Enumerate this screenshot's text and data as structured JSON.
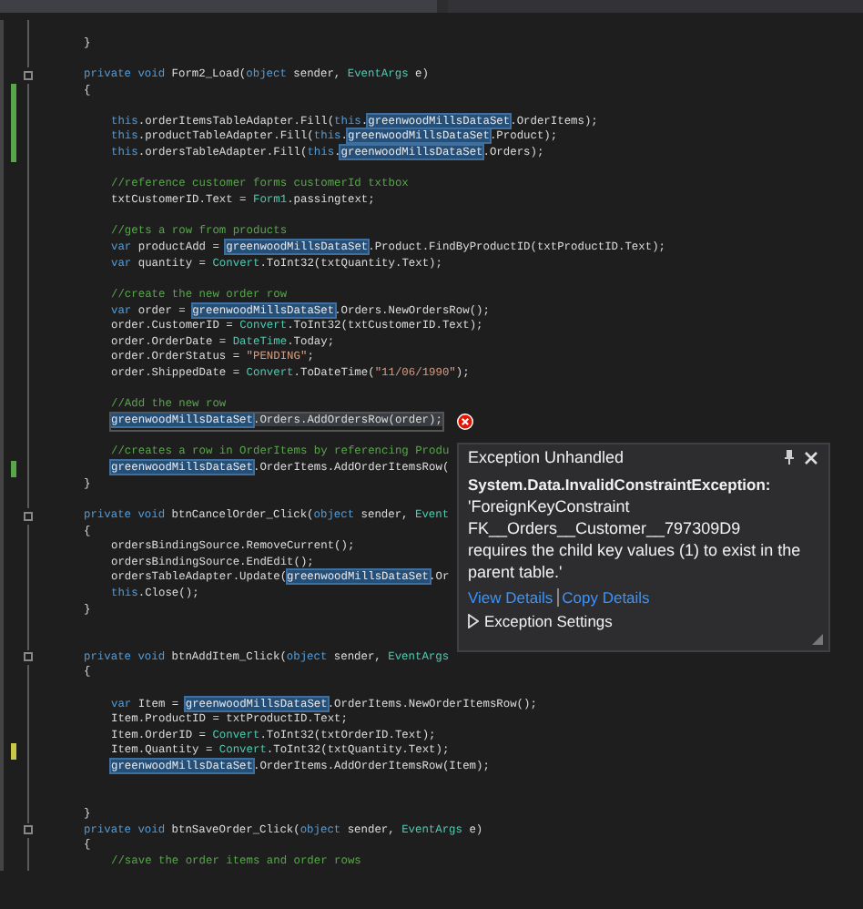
{
  "editor": {
    "lines": [
      {
        "kind": "blank"
      },
      {
        "kind": "member",
        "tokens": [
          {
            "kind": "plain",
            "s": "}"
          }
        ]
      },
      {
        "kind": "blank"
      },
      {
        "kind": "member",
        "fold": true,
        "tokens": [
          {
            "kind": "kw",
            "s": "private void "
          },
          {
            "kind": "plain",
            "s": "Form2_Load("
          },
          {
            "kind": "kw",
            "s": "object "
          },
          {
            "kind": "plain",
            "s": "sender, "
          },
          {
            "kind": "type",
            "s": "EventArgs "
          },
          {
            "kind": "plain",
            "s": "e)"
          }
        ]
      },
      {
        "kind": "member",
        "changed": true,
        "saved": true,
        "tokens": [
          {
            "kind": "plain",
            "s": "{"
          }
        ]
      },
      {
        "kind": "blank",
        "changed": true,
        "saved": true
      },
      {
        "kind": "body",
        "changed": true,
        "saved": true,
        "tokens": [
          {
            "kind": "kw",
            "s": "this"
          },
          {
            "kind": "plain",
            "s": ".orderItemsTableAdapter.Fill("
          },
          {
            "kind": "kw",
            "s": "this"
          },
          {
            "kind": "plain",
            "s": "."
          },
          {
            "kind": "hl",
            "s": "greenwoodMillsDataSet"
          },
          {
            "kind": "plain",
            "s": ".OrderItems);"
          }
        ]
      },
      {
        "kind": "body",
        "changed": true,
        "saved": true,
        "tokens": [
          {
            "kind": "kw",
            "s": "this"
          },
          {
            "kind": "plain",
            "s": ".productTableAdapter.Fill("
          },
          {
            "kind": "kw",
            "s": "this"
          },
          {
            "kind": "plain",
            "s": "."
          },
          {
            "kind": "hl",
            "s": "greenwoodMillsDataSet"
          },
          {
            "kind": "plain",
            "s": ".Product);"
          }
        ]
      },
      {
        "kind": "body",
        "changed": true,
        "saved": true,
        "tokens": [
          {
            "kind": "kw",
            "s": "this"
          },
          {
            "kind": "plain",
            "s": ".ordersTableAdapter.Fill("
          },
          {
            "kind": "kw",
            "s": "this"
          },
          {
            "kind": "plain",
            "s": "."
          },
          {
            "kind": "hl",
            "s": "greenwoodMillsDataSet"
          },
          {
            "kind": "plain",
            "s": ".Orders);"
          }
        ]
      },
      {
        "kind": "blank"
      },
      {
        "kind": "body",
        "tokens": [
          {
            "kind": "cmt",
            "s": "//reference customer forms customerId txtbox"
          }
        ]
      },
      {
        "kind": "body",
        "tokens": [
          {
            "kind": "plain",
            "s": "txtCustomerID.Text = "
          },
          {
            "kind": "type",
            "s": "Form1"
          },
          {
            "kind": "plain",
            "s": ".passingtext;"
          }
        ]
      },
      {
        "kind": "blank"
      },
      {
        "kind": "body",
        "tokens": [
          {
            "kind": "cmt",
            "s": "//gets a row from products"
          }
        ]
      },
      {
        "kind": "body",
        "tokens": [
          {
            "kind": "kw",
            "s": "var "
          },
          {
            "kind": "plain",
            "s": "productAdd = "
          },
          {
            "kind": "hl",
            "s": "greenwoodMillsDataSet"
          },
          {
            "kind": "plain",
            "s": ".Product.FindByProductID(txtProductID.Text);"
          }
        ]
      },
      {
        "kind": "body",
        "tokens": [
          {
            "kind": "kw",
            "s": "var "
          },
          {
            "kind": "plain",
            "s": "quantity = "
          },
          {
            "kind": "type",
            "s": "Convert"
          },
          {
            "kind": "plain",
            "s": ".ToInt32(txtQuantity.Text);"
          }
        ]
      },
      {
        "kind": "blank"
      },
      {
        "kind": "body",
        "tokens": [
          {
            "kind": "cmt",
            "s": "//create the new order row"
          }
        ]
      },
      {
        "kind": "body",
        "tokens": [
          {
            "kind": "kw",
            "s": "var "
          },
          {
            "kind": "plain",
            "s": "order = "
          },
          {
            "kind": "hl",
            "s": "greenwoodMillsDataSet"
          },
          {
            "kind": "plain",
            "s": ".Orders.NewOrdersRow();"
          }
        ]
      },
      {
        "kind": "body",
        "tokens": [
          {
            "kind": "plain",
            "s": "order.CustomerID = "
          },
          {
            "kind": "type",
            "s": "Convert"
          },
          {
            "kind": "plain",
            "s": ".ToInt32(txtCustomerID.Text);"
          }
        ]
      },
      {
        "kind": "body",
        "tokens": [
          {
            "kind": "plain",
            "s": "order.OrderDate = "
          },
          {
            "kind": "type",
            "s": "DateTime"
          },
          {
            "kind": "plain",
            "s": ".Today;"
          }
        ]
      },
      {
        "kind": "body",
        "tokens": [
          {
            "kind": "plain",
            "s": "order.OrderStatus = "
          },
          {
            "kind": "str",
            "s": "\"PENDING\""
          },
          {
            "kind": "plain",
            "s": ";"
          }
        ]
      },
      {
        "kind": "body",
        "tokens": [
          {
            "kind": "plain",
            "s": "order.ShippedDate = "
          },
          {
            "kind": "type",
            "s": "Convert"
          },
          {
            "kind": "plain",
            "s": ".ToDateTime("
          },
          {
            "kind": "str",
            "s": "\"11/06/1990\""
          },
          {
            "kind": "plain",
            "s": ");"
          }
        ]
      },
      {
        "kind": "blank"
      },
      {
        "kind": "body",
        "tokens": [
          {
            "kind": "cmt",
            "s": "//Add the new row"
          }
        ]
      },
      {
        "kind": "body",
        "current": true,
        "error": true,
        "tokens": [
          {
            "kind": "hl",
            "s": "greenwoodMillsDataSet"
          },
          {
            "kind": "stmt",
            "s": ".Orders.AddOrdersRow(order);"
          }
        ]
      },
      {
        "kind": "blank"
      },
      {
        "kind": "body",
        "tokens": [
          {
            "kind": "cmt",
            "s": "//creates a row in OrderItems by referencing Produ"
          }
        ]
      },
      {
        "kind": "body",
        "changed": true,
        "saved": true,
        "tokens": [
          {
            "kind": "hl",
            "s": "greenwoodMillsDataSet"
          },
          {
            "kind": "plain",
            "s": ".OrderItems.AddOrderItemsRow("
          }
        ]
      },
      {
        "kind": "member",
        "tokens": [
          {
            "kind": "plain",
            "s": "}"
          }
        ]
      },
      {
        "kind": "blank"
      },
      {
        "kind": "member",
        "fold": true,
        "tokens": [
          {
            "kind": "kw",
            "s": "private void "
          },
          {
            "kind": "plain",
            "s": "btnCancelOrder_Click("
          },
          {
            "kind": "kw",
            "s": "object "
          },
          {
            "kind": "plain",
            "s": "sender, "
          },
          {
            "kind": "type",
            "s": "Event"
          }
        ]
      },
      {
        "kind": "member",
        "tokens": [
          {
            "kind": "plain",
            "s": "{"
          }
        ]
      },
      {
        "kind": "body",
        "tokens": [
          {
            "kind": "plain",
            "s": "ordersBindingSource.RemoveCurrent();"
          }
        ]
      },
      {
        "kind": "body",
        "tokens": [
          {
            "kind": "plain",
            "s": "ordersBindingSource.EndEdit();"
          }
        ]
      },
      {
        "kind": "body",
        "tokens": [
          {
            "kind": "plain",
            "s": "ordersTableAdapter.Update("
          },
          {
            "kind": "hl",
            "s": "greenwoodMillsDataSet"
          },
          {
            "kind": "plain",
            "s": ".Or"
          }
        ]
      },
      {
        "kind": "body",
        "tokens": [
          {
            "kind": "kw",
            "s": "this"
          },
          {
            "kind": "plain",
            "s": ".Close();"
          }
        ]
      },
      {
        "kind": "member",
        "tokens": [
          {
            "kind": "plain",
            "s": "}"
          }
        ]
      },
      {
        "kind": "blank"
      },
      {
        "kind": "blank"
      },
      {
        "kind": "member",
        "fold": true,
        "tokens": [
          {
            "kind": "kw",
            "s": "private void "
          },
          {
            "kind": "plain",
            "s": "btnAddItem_Click("
          },
          {
            "kind": "kw",
            "s": "object "
          },
          {
            "kind": "plain",
            "s": "sender, "
          },
          {
            "kind": "type",
            "s": "EventArgs"
          }
        ]
      },
      {
        "kind": "member",
        "tokens": [
          {
            "kind": "plain",
            "s": "{"
          }
        ]
      },
      {
        "kind": "blank"
      },
      {
        "kind": "body",
        "tokens": [
          {
            "kind": "kw",
            "s": "var "
          },
          {
            "kind": "plain",
            "s": "Item = "
          },
          {
            "kind": "hl",
            "s": "greenwoodMillsDataSet"
          },
          {
            "kind": "plain",
            "s": ".OrderItems.NewOrderItemsRow();"
          }
        ]
      },
      {
        "kind": "body",
        "tokens": [
          {
            "kind": "plain",
            "s": "Item.ProductID = txtProductID.Text;"
          }
        ]
      },
      {
        "kind": "body",
        "tokens": [
          {
            "kind": "plain",
            "s": "Item.OrderID = "
          },
          {
            "kind": "type",
            "s": "Convert"
          },
          {
            "kind": "plain",
            "s": ".ToInt32(txtOrderID.Text);"
          }
        ]
      },
      {
        "kind": "body",
        "changed": true,
        "saved": false,
        "tokens": [
          {
            "kind": "plain",
            "s": "Item.Quantity = "
          },
          {
            "kind": "type",
            "s": "Convert"
          },
          {
            "kind": "plain",
            "s": ".ToInt32(txtQuantity.Text);"
          }
        ]
      },
      {
        "kind": "body",
        "tokens": [
          {
            "kind": "hl",
            "s": "greenwoodMillsDataSet"
          },
          {
            "kind": "plain",
            "s": ".OrderItems.AddOrderItemsRow(Item);"
          }
        ]
      },
      {
        "kind": "blank"
      },
      {
        "kind": "blank"
      },
      {
        "kind": "member",
        "tokens": [
          {
            "kind": "plain",
            "s": "}"
          }
        ]
      },
      {
        "kind": "member",
        "fold": true,
        "tokens": [
          {
            "kind": "kw",
            "s": "private void "
          },
          {
            "kind": "plain",
            "s": "btnSaveOrder_Click("
          },
          {
            "kind": "kw",
            "s": "object "
          },
          {
            "kind": "plain",
            "s": "sender, "
          },
          {
            "kind": "type",
            "s": "EventArgs "
          },
          {
            "kind": "plain",
            "s": "e)"
          }
        ]
      },
      {
        "kind": "member",
        "tokens": [
          {
            "kind": "plain",
            "s": "{"
          }
        ]
      },
      {
        "kind": "body",
        "tokens": [
          {
            "kind": "cmt",
            "s": "//save the order items and order rows"
          }
        ]
      }
    ]
  },
  "exception_popup": {
    "title": "Exception Unhandled",
    "exception_type": "System.Data.InvalidConstraintException:",
    "message": "'ForeignKeyConstraint FK__Orders__Customer__797309D9 requires the child key values (1) to exist in the parent table.'",
    "links": [
      "View Details",
      "Copy Details"
    ],
    "settings": {
      "label": "Exception Settings",
      "expanded": false
    }
  }
}
